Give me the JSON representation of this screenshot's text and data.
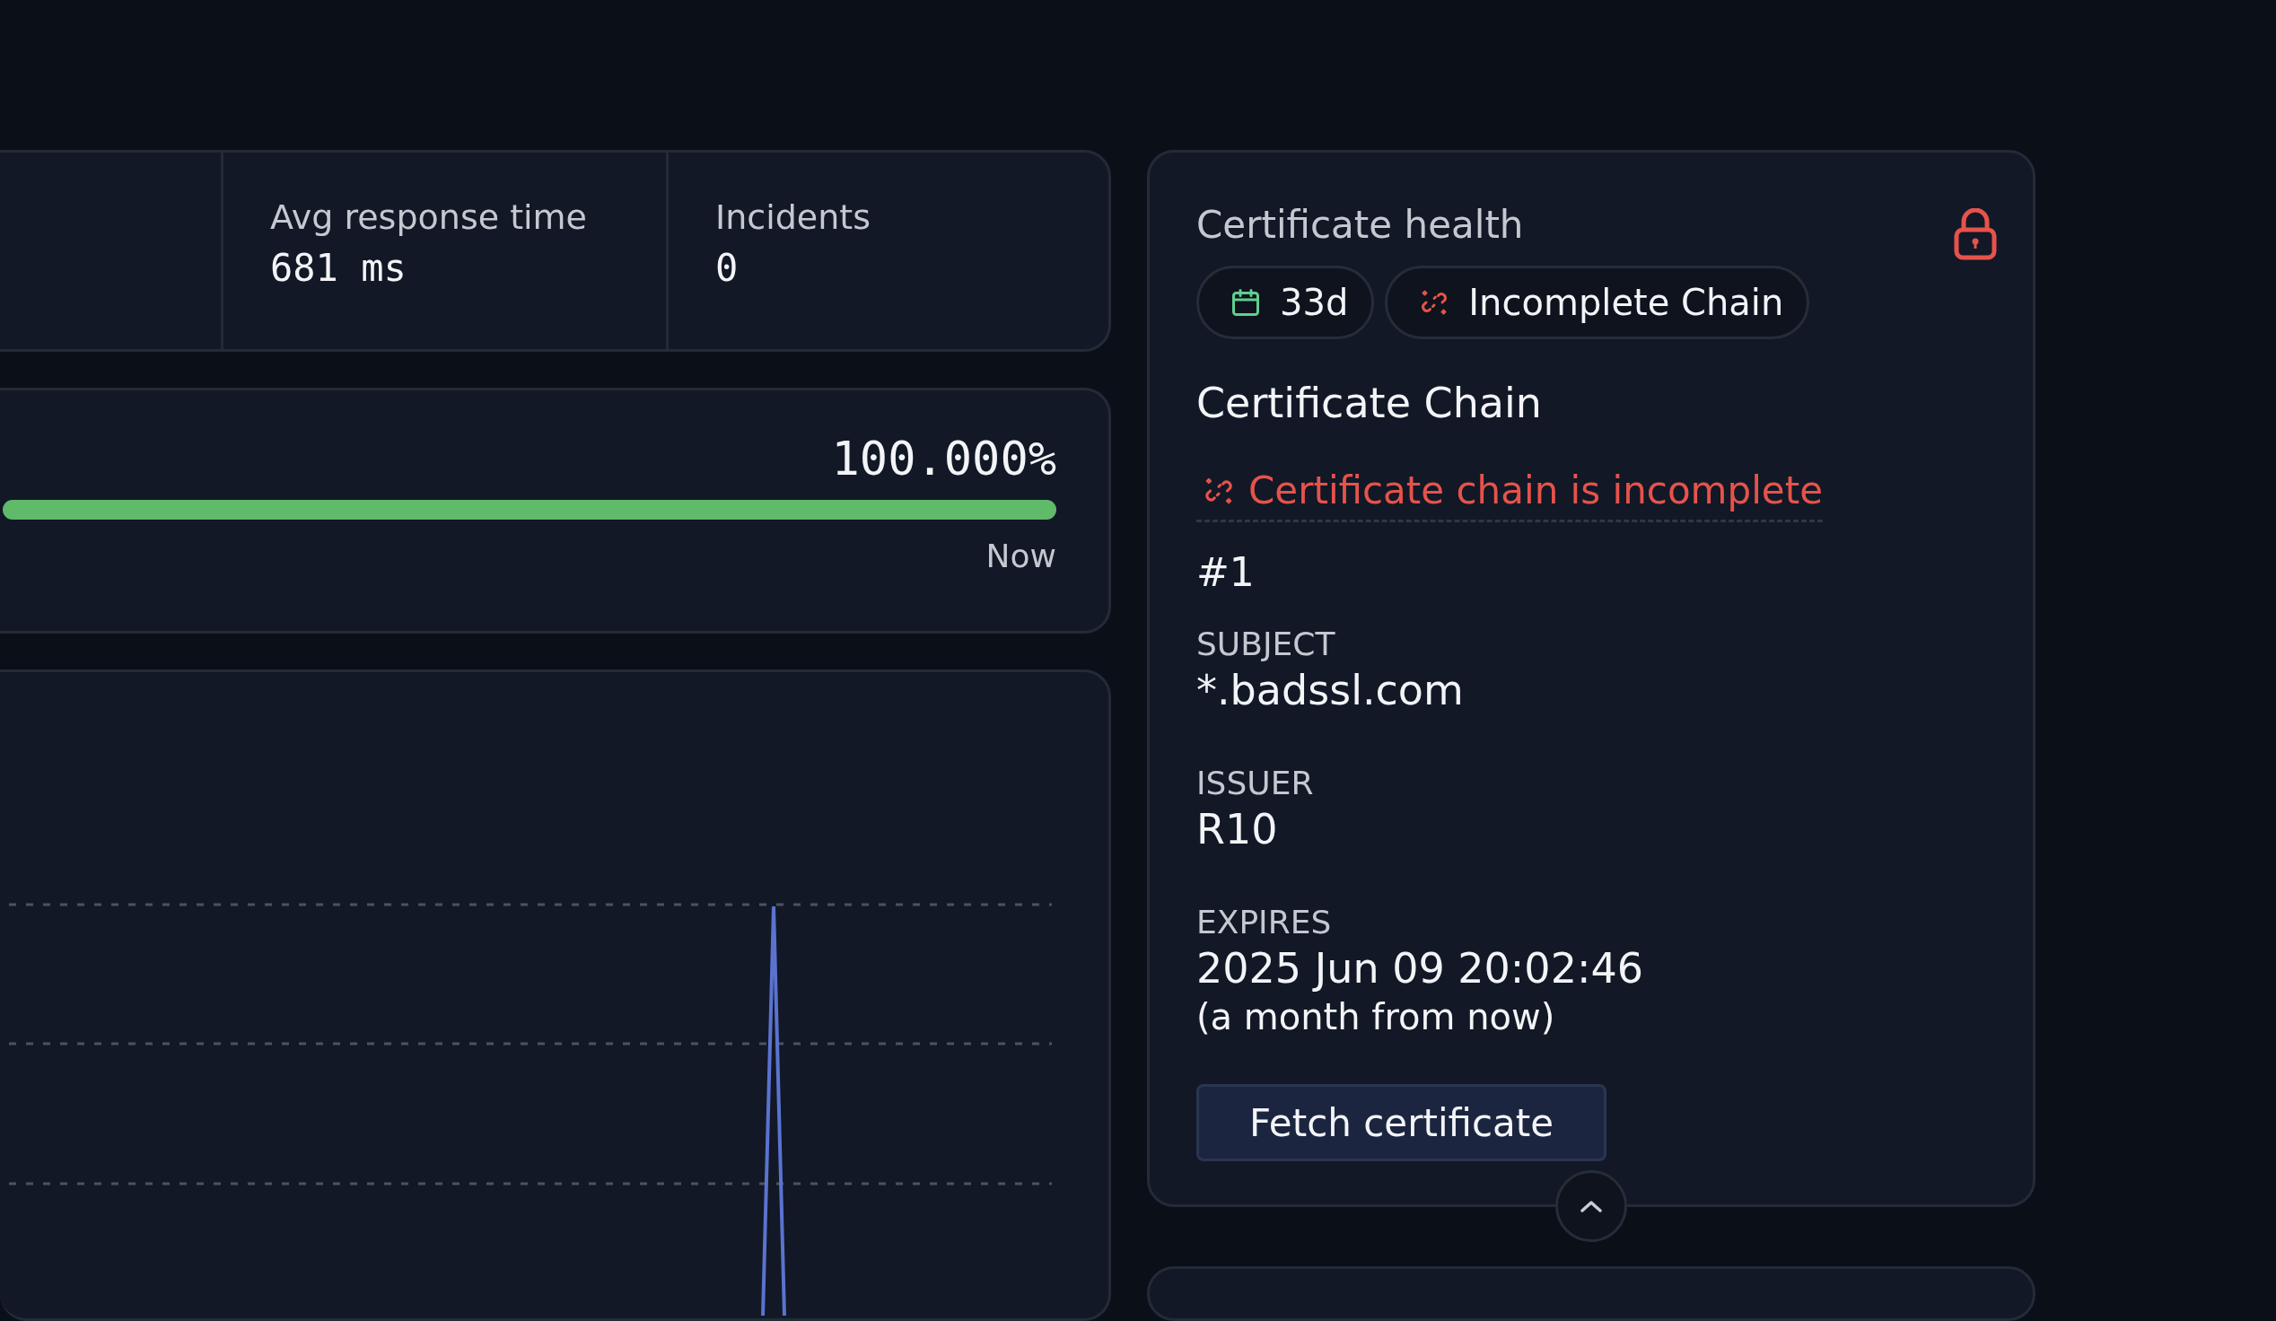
{
  "stats": [
    {
      "label": "Avg response time",
      "value": "681 ms"
    },
    {
      "label": "Incidents",
      "value": "0"
    }
  ],
  "uptime": {
    "percent": "100.000%",
    "level": 1,
    "end_label": "Now"
  },
  "certificate": {
    "title": "Certificate health",
    "pills": [
      {
        "kind": "expiry",
        "label": "33d"
      },
      {
        "kind": "chain",
        "label": "Incomplete Chain"
      }
    ],
    "chain_heading": "Certificate Chain",
    "warning": "Certificate chain is incomplete",
    "entries": [
      {
        "number": "#1",
        "fields": [
          {
            "label": "SUBJECT",
            "value": "*.badssl.com"
          },
          {
            "label": "ISSUER",
            "value": "R10"
          },
          {
            "label": "EXPIRES",
            "value": "2025 Jun 09 20:02:46",
            "note": "(a month from now)"
          }
        ]
      }
    ],
    "button": "Fetch certificate"
  }
}
